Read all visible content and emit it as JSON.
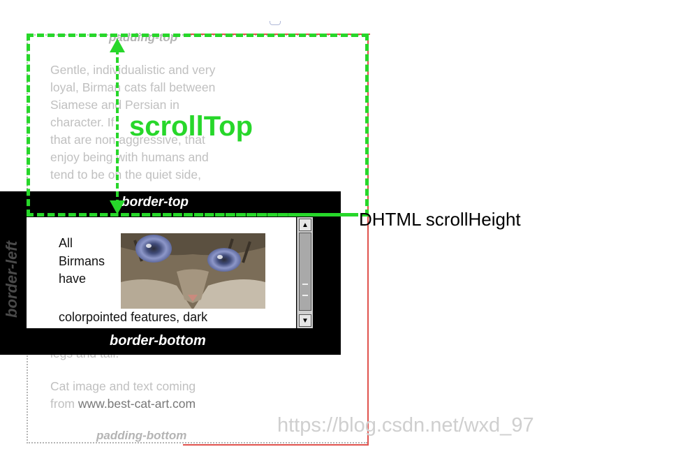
{
  "labels": {
    "padding_top": "padding-top",
    "padding_bottom": "padding-bottom",
    "border_top": "border-top",
    "border_bottom": "border-bottom",
    "border_left": "border-left",
    "scroll_top": "scrollTop",
    "scroll_height": "DHTML scrollHeight"
  },
  "hidden_text_top": [
    "Gentle, individualistic and very",
    "loyal, Birman cats fall between",
    "Siamese and Persian in",
    "character. If",
    "that are non aggressive, that",
    "enjoy being with humans and",
    "tend to be on the quiet side,"
  ],
  "hidden_text_bottom": {
    "line1": "legs and tail.",
    "line2": "Cat image and text coming",
    "line3_prefix": "from ",
    "line3_link": "www.best-cat-art.com"
  },
  "visible_text": {
    "lines": [
      "All",
      "Birmans",
      "have"
    ],
    "bottom": "colorpointed features, dark"
  },
  "image": {
    "name": "cat-face"
  },
  "watermark": "https://blog.csdn.net/wxd_97",
  "colors": {
    "scroll_top_annotation": "#27d72a",
    "scroll_height_outline": "#e0524d",
    "element_border": "#000000"
  }
}
